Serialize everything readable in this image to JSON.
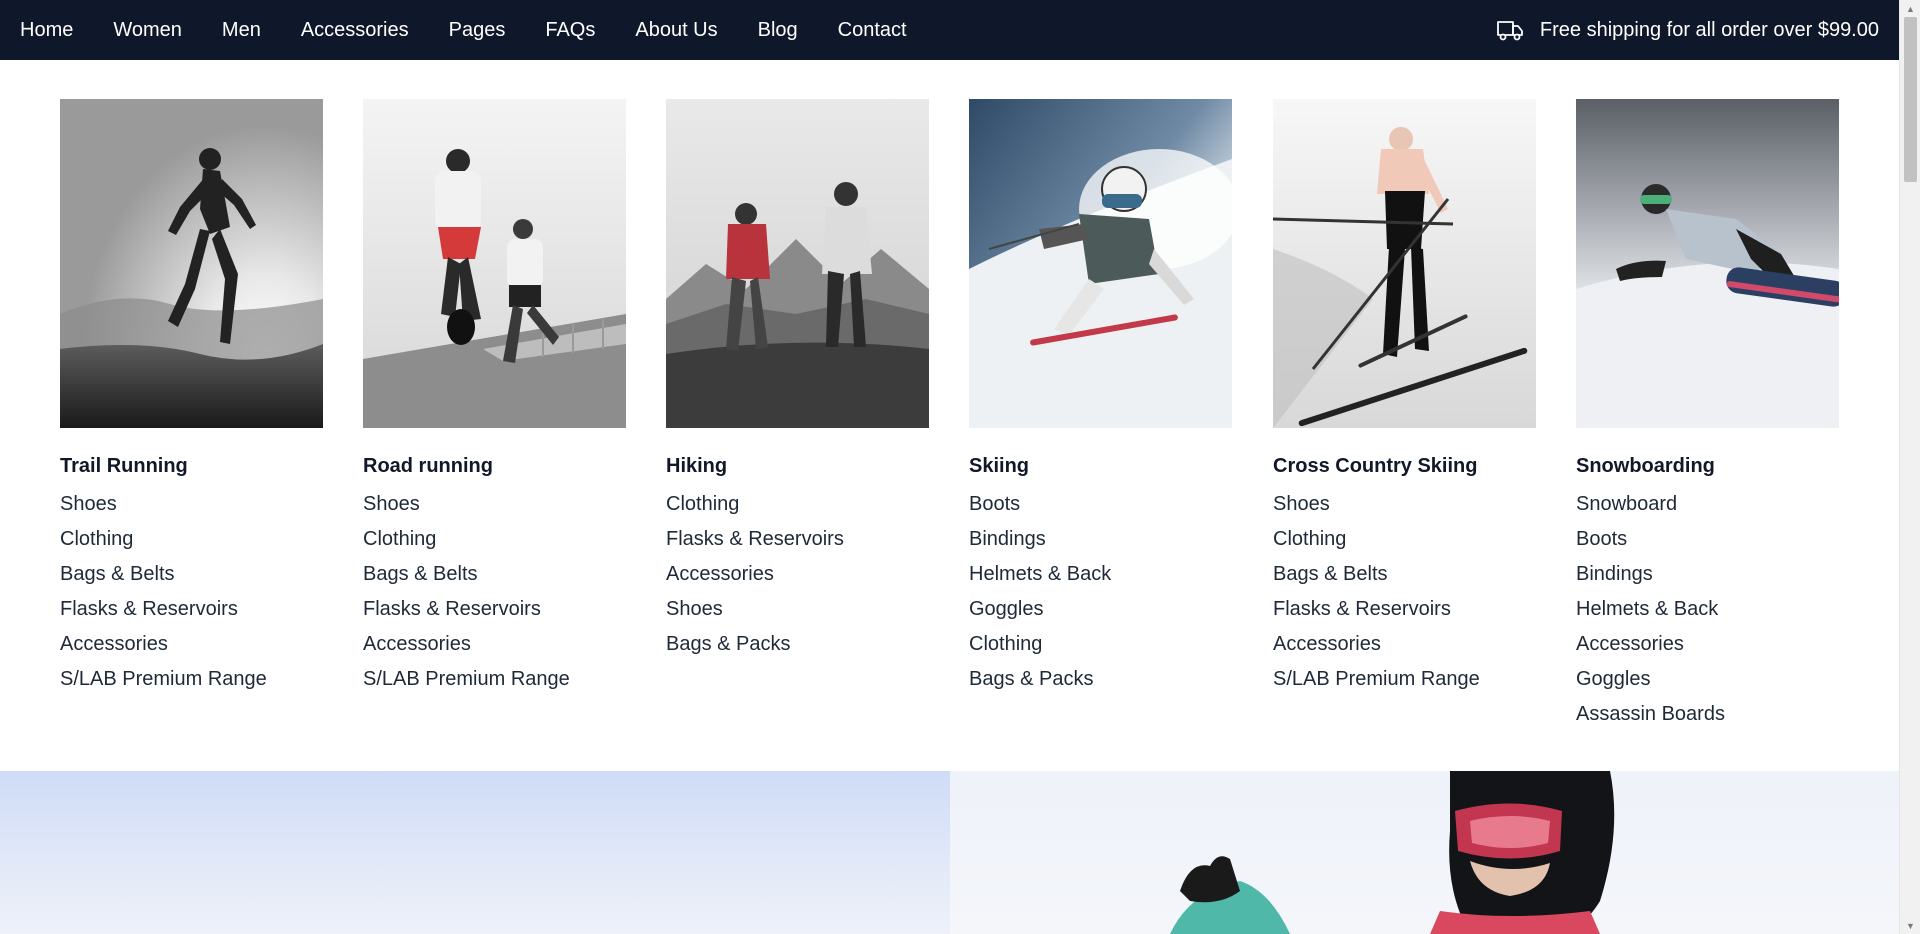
{
  "nav": {
    "items": [
      {
        "label": "Home"
      },
      {
        "label": "Women"
      },
      {
        "label": "Men"
      },
      {
        "label": "Accessories"
      },
      {
        "label": "Pages"
      },
      {
        "label": "FAQs"
      },
      {
        "label": "About Us"
      },
      {
        "label": "Blog"
      },
      {
        "label": "Contact"
      }
    ],
    "shipping_icon": "truck-icon",
    "shipping_text": "Free shipping for all order over $99.00"
  },
  "menu": {
    "columns": [
      {
        "title": "Trail Running",
        "image": "trail-running-photo",
        "links": [
          "Shoes",
          "Clothing",
          "Bags & Belts",
          "Flasks & Reservoirs",
          "Accessories",
          "S/LAB Premium Range"
        ]
      },
      {
        "title": "Road running",
        "image": "road-running-photo",
        "links": [
          "Shoes",
          "Clothing",
          "Bags & Belts",
          "Flasks & Reservoirs",
          "Accessories",
          "S/LAB Premium Range"
        ]
      },
      {
        "title": "Hiking",
        "image": "hiking-photo",
        "links": [
          "Clothing",
          "Flasks & Reservoirs",
          "Accessories",
          "Shoes",
          "Bags & Packs"
        ]
      },
      {
        "title": "Skiing",
        "image": "skiing-photo",
        "links": [
          "Boots",
          "Bindings",
          "Helmets & Back",
          "Goggles",
          "Clothing",
          "Bags & Packs"
        ]
      },
      {
        "title": "Cross Country Skiing",
        "image": "cross-country-skiing-photo",
        "links": [
          "Shoes",
          "Clothing",
          "Bags & Belts",
          "Flasks & Reservoirs",
          "Accessories",
          "S/LAB Premium Range"
        ]
      },
      {
        "title": "Snowboarding",
        "image": "snowboarding-photo",
        "links": [
          "Snowboard",
          "Boots",
          "Bindings",
          "Helmets & Back",
          "Accessories",
          "Goggles",
          "Assassin Boards"
        ]
      }
    ]
  },
  "colors": {
    "nav_bg": "#0f172a",
    "nav_text": "#ffffff",
    "text": "#111827"
  }
}
